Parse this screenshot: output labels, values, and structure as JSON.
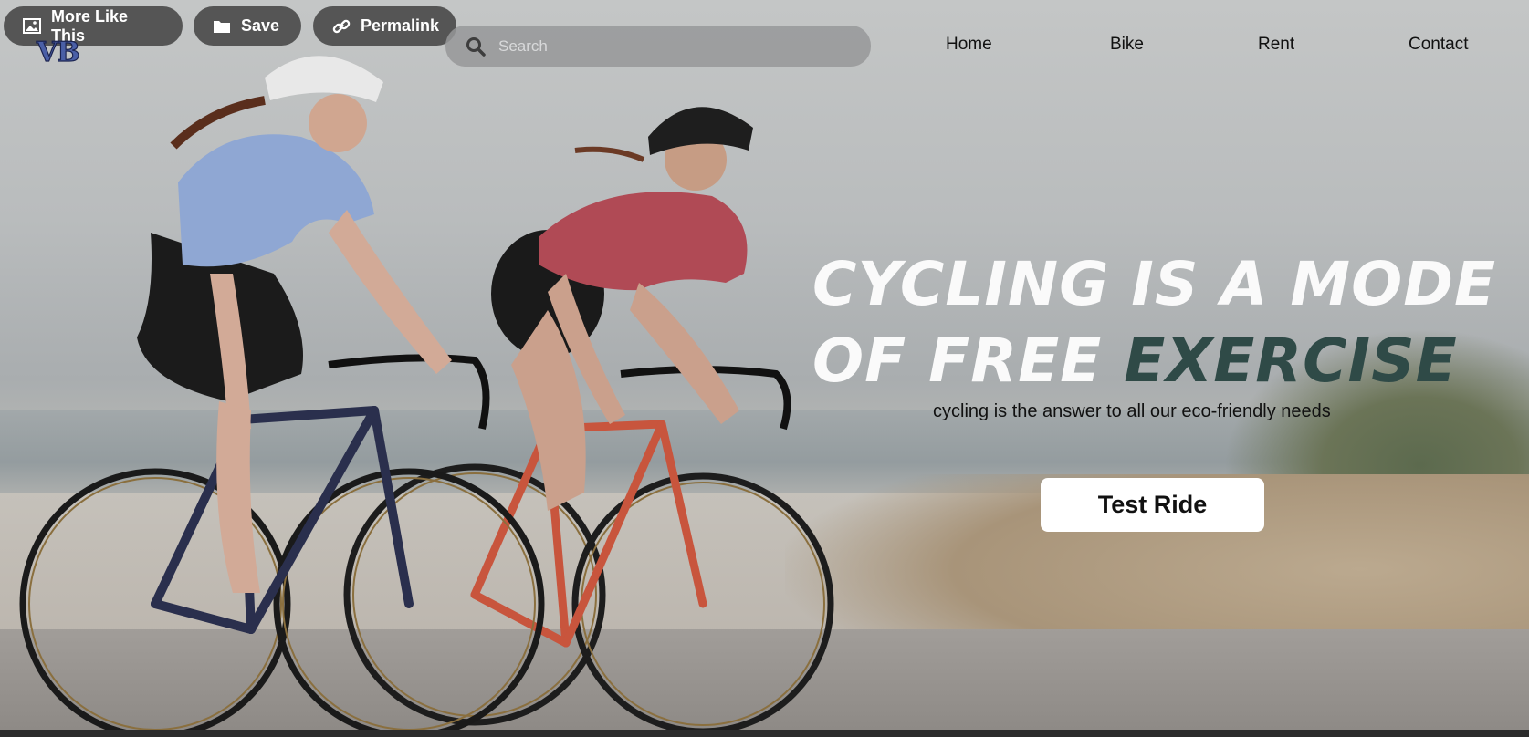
{
  "overlay_buttons": {
    "more_like_this": "More Like This",
    "save": "Save",
    "permalink": "Permalink"
  },
  "logo": {
    "text": "VB"
  },
  "search": {
    "placeholder": "Search",
    "value": ""
  },
  "nav": {
    "home": "Home",
    "bike": "Bike",
    "rent": "Rent",
    "contact": "Contact"
  },
  "hero": {
    "headline_line1": "CYCLING IS A MODE",
    "headline_line2_prefix": "OF FREE ",
    "headline_line2_accent": "EXERCISE",
    "subline": "cycling is the answer to all our eco-friendly needs",
    "cta_label": "Test Ride"
  },
  "colors": {
    "accent": "#2f4a47",
    "overlay_button_bg": "#464646",
    "cta_bg": "#ffffff",
    "logo": "#4a5fa6"
  },
  "icons": {
    "more_like_this": "image-icon",
    "save": "folder-icon",
    "permalink": "link-icon",
    "search": "search-icon"
  }
}
